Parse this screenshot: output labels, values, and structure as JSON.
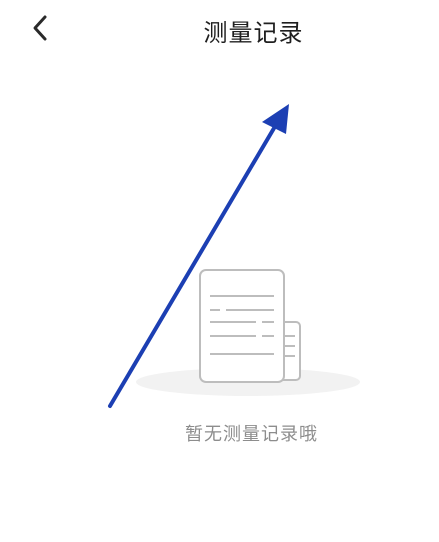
{
  "header": {
    "back_icon": "chevron-left-icon",
    "title": "测量记录"
  },
  "empty_state": {
    "illustration_icon": "document-icon",
    "message": "暂无测量记录哦"
  },
  "annotation": {
    "arrow_icon": "arrow-icon",
    "arrow_color": "#1c3fb3"
  },
  "colors": {
    "background": "#ffffff",
    "title_text": "#1f1f1f",
    "empty_text": "#8d8d8d",
    "illustration_stroke": "#bdbdbd",
    "illustration_shadow": "#f2f2f2"
  }
}
